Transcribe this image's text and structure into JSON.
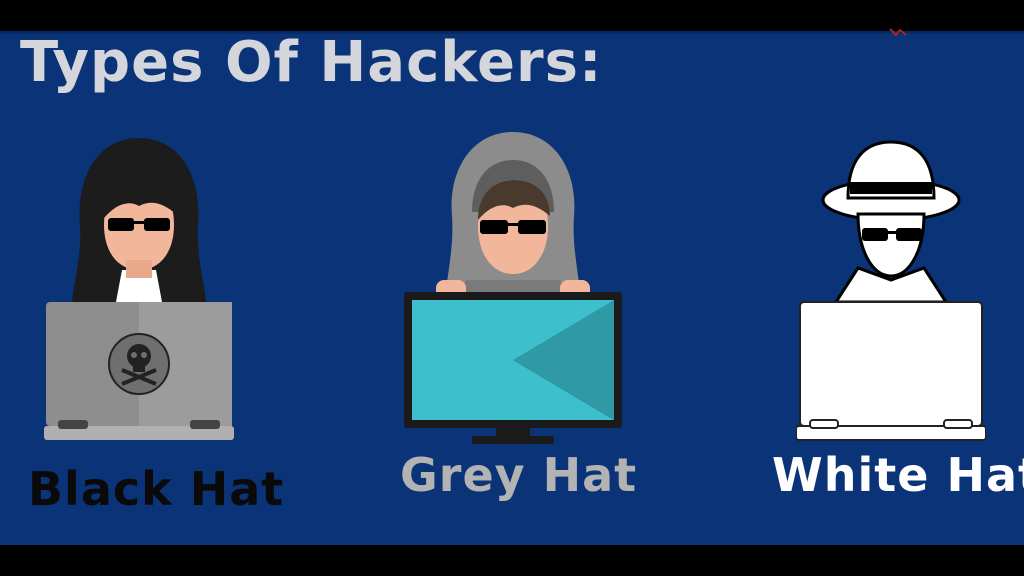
{
  "title": "Types Of Hackers:",
  "hackers": [
    {
      "label": "Black Hat"
    },
    {
      "label": "Grey Hat"
    },
    {
      "label": "White Hat"
    }
  ],
  "colors": {
    "background": "#0b3378",
    "title": "#d4d6dc",
    "black_hat_label": "#0a0a0a",
    "grey_hat_label": "#b3b3b3",
    "white_hat_label": "#ffffff",
    "monitor_screen": "#3ec0cc"
  }
}
